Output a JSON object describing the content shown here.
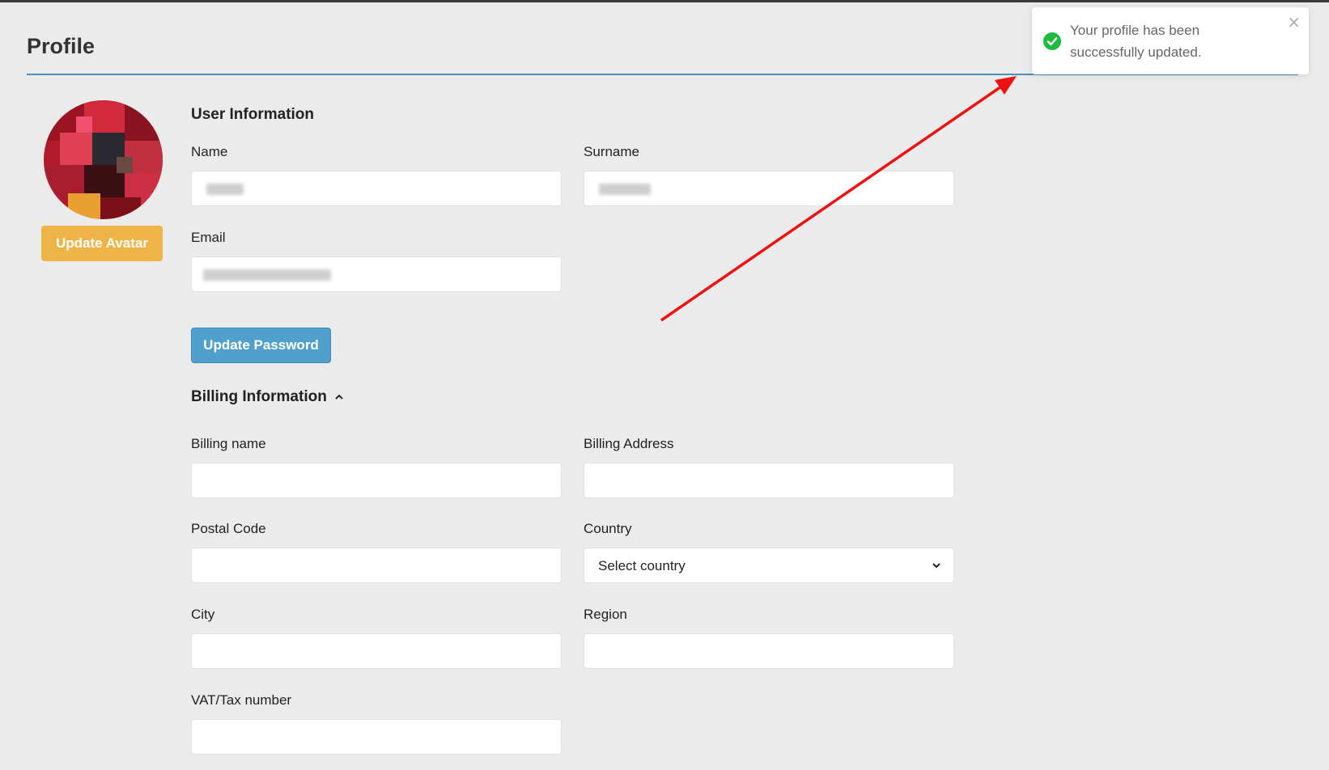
{
  "page": {
    "title": "Profile"
  },
  "avatar": {
    "button_label": "Update Avatar"
  },
  "user_info": {
    "heading": "User Information",
    "name_label": "Name",
    "surname_label": "Surname",
    "email_label": "Email",
    "password_button": "Update Password"
  },
  "billing": {
    "heading": "Billing Information",
    "billing_name_label": "Billing name",
    "billing_address_label": "Billing Address",
    "postal_code_label": "Postal Code",
    "country_label": "Country",
    "country_value": "Select country",
    "city_label": "City",
    "region_label": "Region",
    "vat_label": "VAT/Tax number"
  },
  "toast": {
    "message": "Your profile has been successfully updated.",
    "close": "×",
    "icon": "check-circle-icon",
    "color": "#1dbb3f"
  },
  "colors": {
    "avatar_button": "#efb447",
    "password_button": "#4fa0cc",
    "divider": "#4a8fb8",
    "annotation_arrow": "#ee1111"
  }
}
